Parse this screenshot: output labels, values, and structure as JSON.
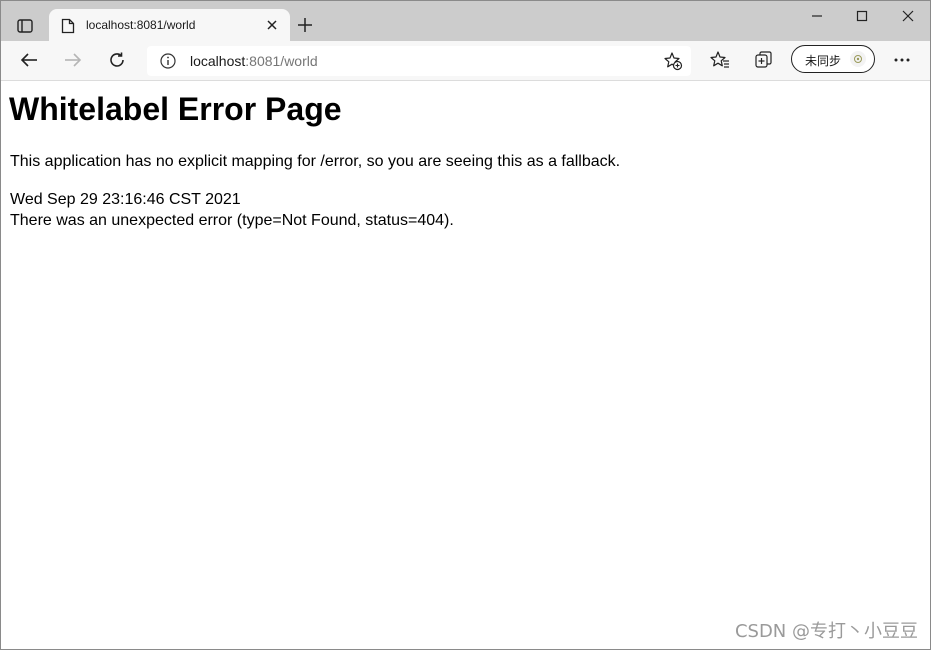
{
  "browser": {
    "tab": {
      "title": "localhost:8081/world",
      "favicon": "page-icon",
      "close_icon": "close-icon"
    },
    "new_tab_icon": "plus-icon",
    "tab_actions_icon": "tab-actions-icon",
    "window_controls": {
      "minimize_icon": "minimize-icon",
      "maximize_icon": "maximize-icon",
      "close_icon": "close-icon"
    },
    "toolbar": {
      "back_icon": "back-arrow-icon",
      "forward_icon": "forward-arrow-icon",
      "refresh_icon": "refresh-icon",
      "favorites_icon": "favorites-icon",
      "collections_icon": "collections-icon",
      "more_icon": "more-icon",
      "profile_label": "未同步"
    },
    "address_bar": {
      "host": "localhost",
      "rest": ":8081/world",
      "info_icon": "info-icon",
      "add_favorite_icon": "add-favorite-icon"
    }
  },
  "page": {
    "heading": "Whitelabel Error Page",
    "description": "This application has no explicit mapping for /error, so you are seeing this as a fallback.",
    "timestamp": "Wed Sep 29 23:16:46 CST 2021",
    "error_message": "There was an unexpected error (type=Not Found, status=404)."
  },
  "watermark": "CSDN @专打丶小豆豆",
  "colors": {
    "tabstrip_bg": "#cccccc",
    "toolbar_bg": "#f7f7f7",
    "page_bg": "#ffffff"
  }
}
